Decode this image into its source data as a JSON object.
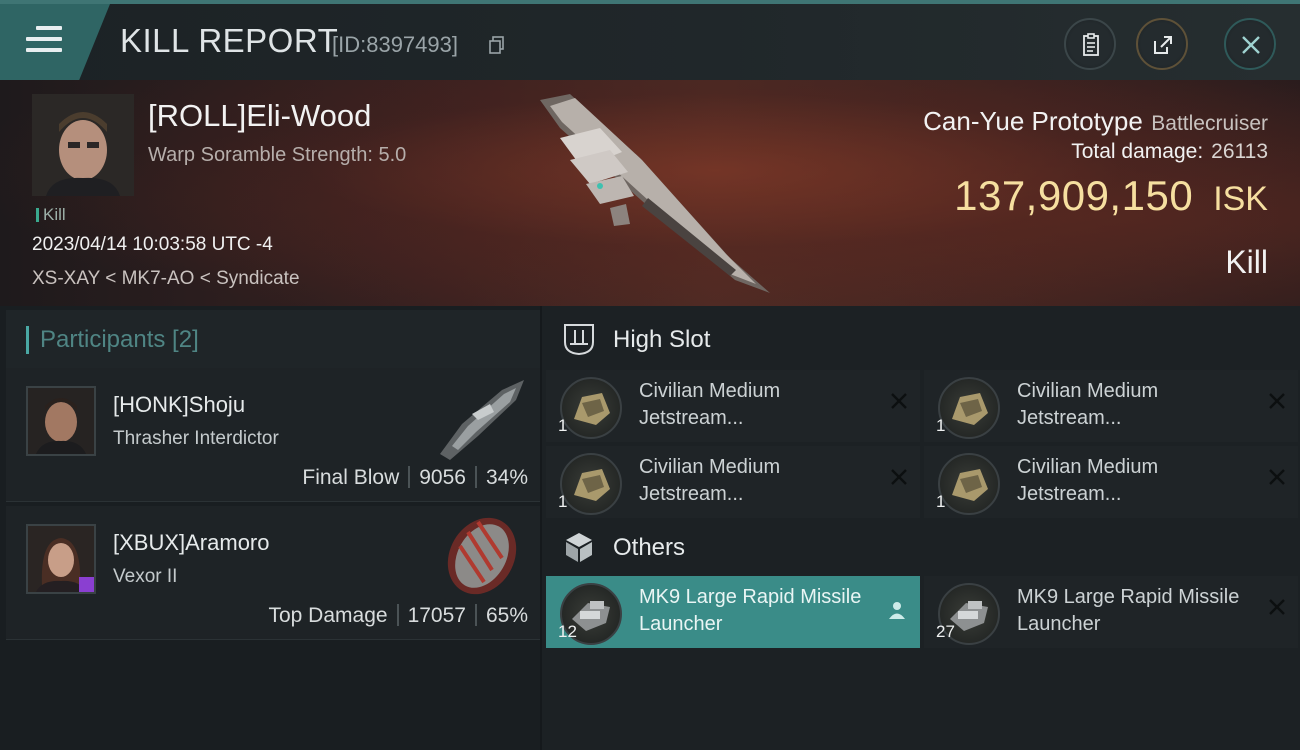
{
  "header": {
    "title": "KILL REPORT",
    "report_id": "[ID:8397493]"
  },
  "victim": {
    "name": "[ROLL]Eli-Wood",
    "scramble": "Warp Soramble Strength: 5.0",
    "tag": "Kill",
    "datetime": "2023/04/14 10:03:58 UTC -4",
    "location": "XS-XAY < MK7-AO < Syndicate",
    "ship_name": "Can-Yue Prototype",
    "ship_class": "Battlecruiser",
    "total_damage_label": "Total damage:",
    "total_damage": "26113",
    "isk_value": "137,909,150",
    "isk_unit": "ISK",
    "result": "Kill"
  },
  "participants": {
    "title": "Participants [2]",
    "list": [
      {
        "name": "[HONK]Shoju",
        "ship": "Thrasher Interdictor",
        "role": "Final Blow",
        "damage": "9056",
        "percent": "34%"
      },
      {
        "name": "[XBUX]Aramoro",
        "ship": "Vexor II",
        "role": "Top Damage",
        "damage": "17057",
        "percent": "65%"
      }
    ]
  },
  "high_slot": {
    "title": "High Slot",
    "modules": [
      {
        "name": "Civilian Medium Jetstream...",
        "qty": "1"
      },
      {
        "name": "Civilian Medium Jetstream...",
        "qty": "1"
      },
      {
        "name": "Civilian Medium Jetstream...",
        "qty": "1"
      },
      {
        "name": "Civilian Medium Jetstream...",
        "qty": "1"
      }
    ]
  },
  "others": {
    "title": "Others",
    "modules": [
      {
        "name": "MK9 Large Rapid Missile Launcher",
        "qty": "12"
      },
      {
        "name": "MK9 Large Rapid Missile Launcher",
        "qty": "27"
      }
    ]
  },
  "colors": {
    "accent": "#3a8c88",
    "isk": "#f6dfa0",
    "menu_tab": "#2f6564"
  },
  "icons": {
    "menu": "hamburger-menu-icon",
    "copy": "copy-icon",
    "clipboard": "clipboard-icon",
    "share": "share-icon",
    "close": "close-icon",
    "high_slot": "high-slot-icon",
    "others": "cube-icon",
    "remove": "x-icon",
    "owner": "person-icon"
  }
}
